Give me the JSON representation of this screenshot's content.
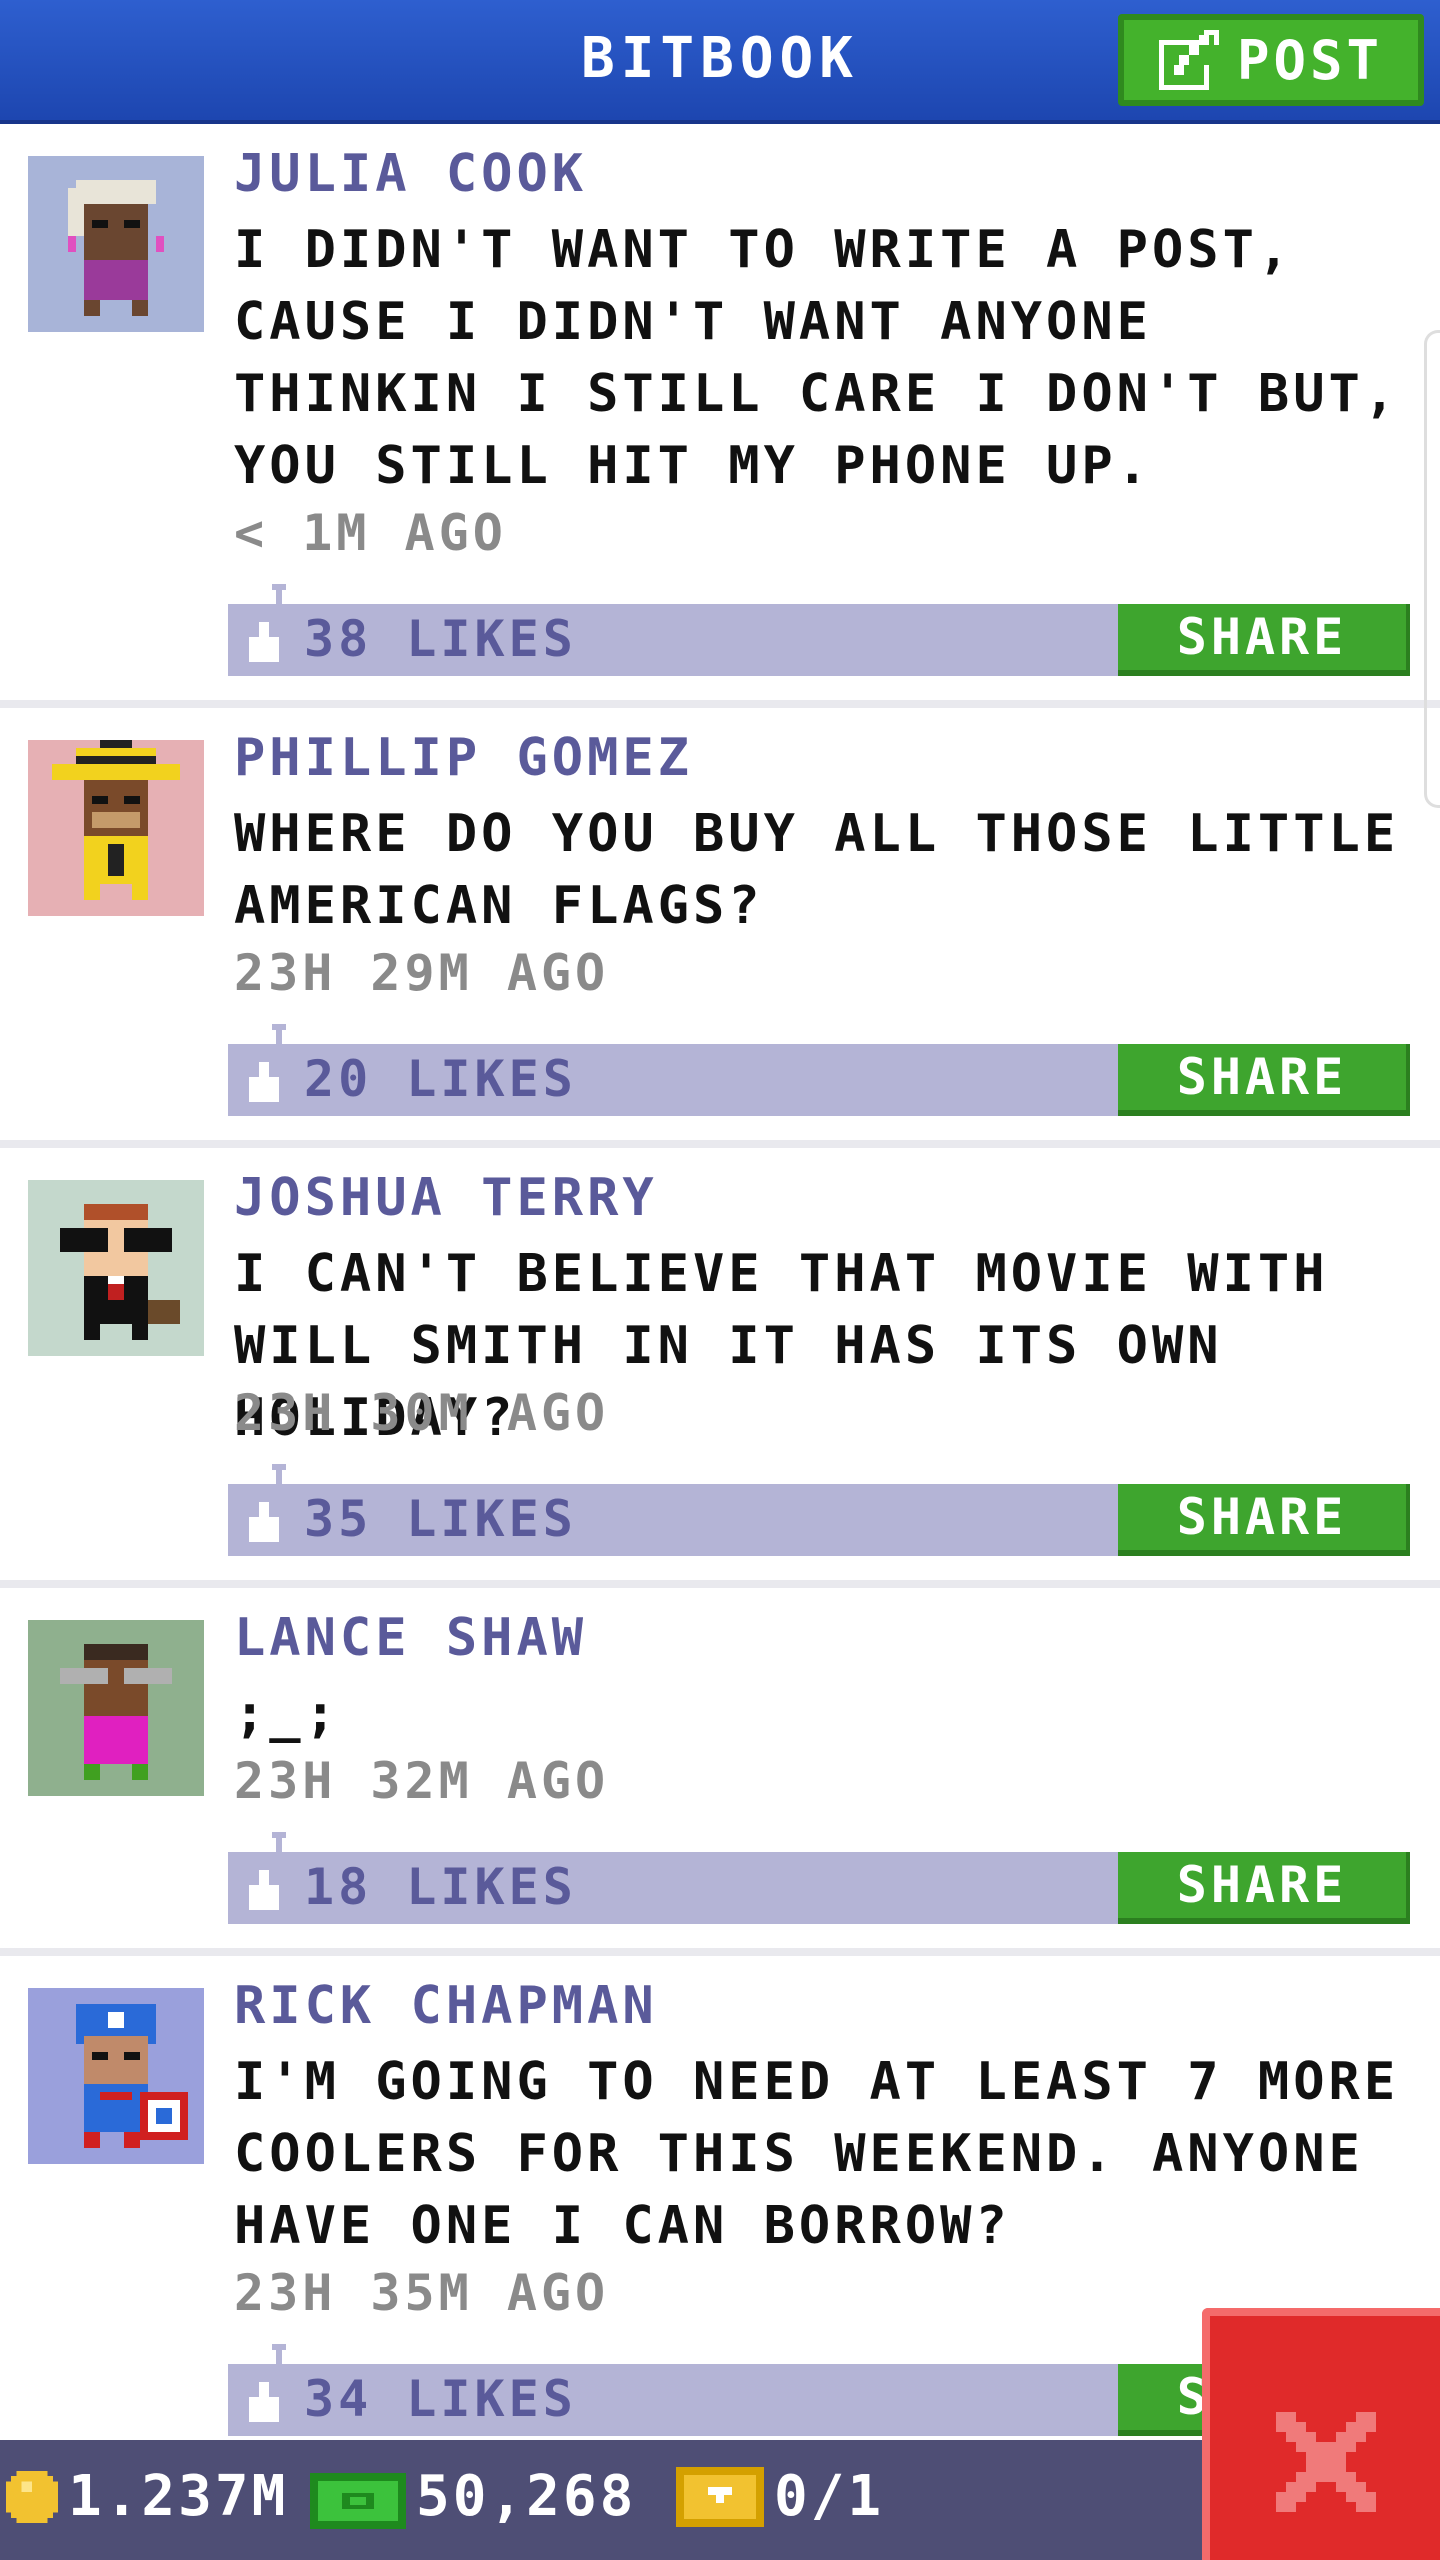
{
  "header": {
    "title": "BITBOOK",
    "post_label": "POST"
  },
  "posts": [
    {
      "author": "JULIA COOK",
      "message": "I DIDN'T WANT TO WRITE A POST, CAUSE I DIDN'T WANT ANYONE THINKIN I STILL CARE I DON'T BUT, YOU STILL HIT MY PHONE UP.",
      "time": "< 1M AGO",
      "likes": "38 LIKES",
      "share": "SHARE",
      "avatar_bg": "#a8b4d8"
    },
    {
      "author": "PHILLIP GOMEZ",
      "message": "WHERE DO YOU BUY ALL THOSE LITTLE AMERICAN FLAGS?",
      "time": "23H 29M AGO",
      "likes": "20 LIKES",
      "share": "SHARE",
      "avatar_bg": "#e6b0b4"
    },
    {
      "author": "JOSHUA TERRY",
      "message": "I CAN'T BELIEVE THAT MOVIE WITH WILL SMITH IN IT HAS ITS OWN HOLIDAY?",
      "time": "23H 30M AGO",
      "likes": "35 LIKES",
      "share": "SHARE",
      "avatar_bg": "#c4d8cc"
    },
    {
      "author": "LANCE SHAW",
      "message": ";_;",
      "time": "23H 32M AGO",
      "likes": "18 LIKES",
      "share": "SHARE",
      "avatar_bg": "#8fb08e"
    },
    {
      "author": "RICK CHAPMAN",
      "message": "I'M GOING TO NEED AT LEAST 7 MORE COOLERS FOR THIS WEEKEND. ANYONE HAVE ONE I CAN BORROW?",
      "time": "23H 35M AGO",
      "likes": "34 LIKES",
      "share": "SHARE",
      "avatar_bg": "#9aa0dc"
    }
  ],
  "bottom_bar": {
    "coins": "1.237M",
    "bux": "50,268",
    "tickets": "0/1"
  },
  "colors": {
    "header": "#1d46b0",
    "accent_green": "#3ea52e",
    "likes_bar": "#b4b4d6",
    "close_red": "#e02a2a"
  },
  "icons": [
    "edit-icon",
    "like-icon",
    "coin-icon",
    "bux-icon",
    "ticket-icon",
    "close-icon"
  ]
}
